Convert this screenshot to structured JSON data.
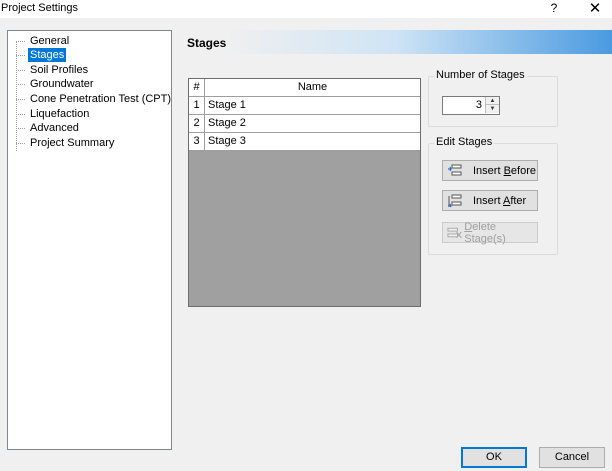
{
  "window": {
    "title": "Project Settings",
    "help_label": "?",
    "close_label": "✕"
  },
  "tree": {
    "items": [
      {
        "label": "General",
        "selected": false
      },
      {
        "label": "Stages",
        "selected": true
      },
      {
        "label": "Soil Profiles",
        "selected": false
      },
      {
        "label": "Groundwater",
        "selected": false
      },
      {
        "label": "Cone Penetration Test (CPT)",
        "selected": false
      },
      {
        "label": "Liquefaction",
        "selected": false
      },
      {
        "label": "Advanced",
        "selected": false
      },
      {
        "label": "Project Summary",
        "selected": false
      }
    ]
  },
  "header": {
    "title": "Stages"
  },
  "grid": {
    "columns": [
      "#",
      "Name"
    ],
    "rows": [
      {
        "num": "1",
        "name": "Stage 1"
      },
      {
        "num": "2",
        "name": "Stage 2"
      },
      {
        "num": "3",
        "name": "Stage 3"
      }
    ]
  },
  "num_stages": {
    "label": "Number of Stages",
    "value": "3"
  },
  "edit_stages": {
    "label": "Edit Stages",
    "insert_before": {
      "pre": "Insert ",
      "key": "B",
      "post": "efore"
    },
    "insert_after": {
      "pre": "Insert ",
      "key": "A",
      "post": "fter"
    },
    "delete": {
      "pre": "",
      "key": "D",
      "post": "elete Stage(s)"
    }
  },
  "footer": {
    "ok_label": "OK",
    "cancel_label": "Cancel"
  },
  "colors": {
    "selection": "#0078d7",
    "grid_empty": "#a0a0a0",
    "header_gradient_end": "#4a9ae0"
  }
}
